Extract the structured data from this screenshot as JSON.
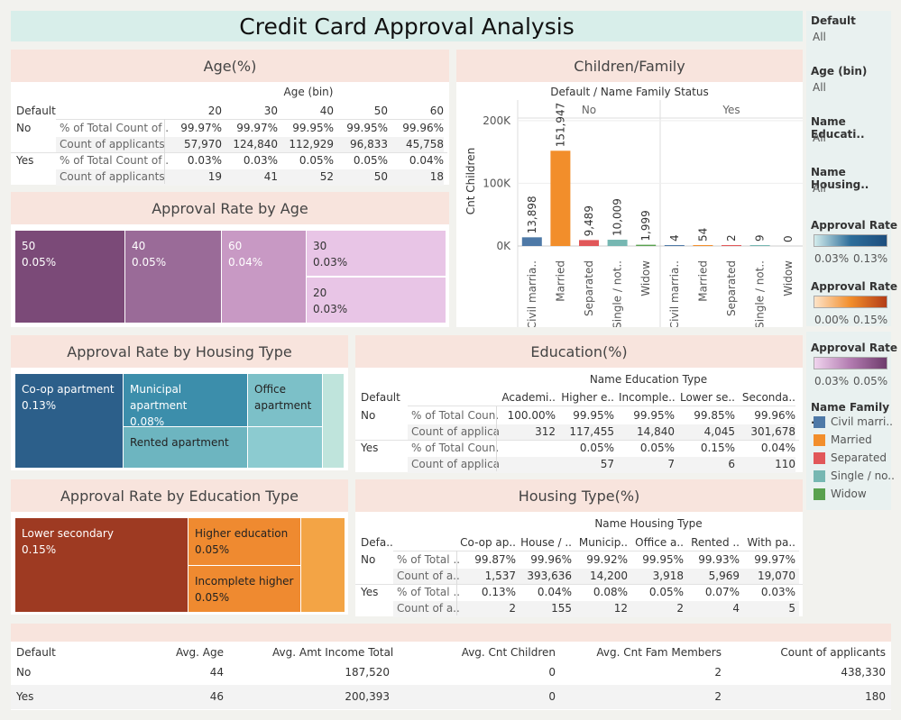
{
  "title": "Credit Card Approval Analysis",
  "filters": [
    {
      "label": "Default",
      "value": "All"
    },
    {
      "label": "Age (bin)",
      "value": "All"
    },
    {
      "label": "Name Educati..",
      "value": "All"
    },
    {
      "label": "Name Housing..",
      "value": "All"
    }
  ],
  "legends": {
    "rate1": {
      "title": "Approval Rate",
      "min": "0.03%",
      "max": "0.13%"
    },
    "rate2": {
      "title": "Approval Rate",
      "min": "0.00%",
      "max": "0.15%"
    },
    "rate3": {
      "title": "Approval Rate",
      "min": "0.03%",
      "max": "0.05%"
    },
    "family": {
      "title": "Name Family ..",
      "items": [
        {
          "label": "Civil marri..",
          "color": "#4e79a7"
        },
        {
          "label": "Married",
          "color": "#f28e2b"
        },
        {
          "label": "Separated",
          "color": "#e15759"
        },
        {
          "label": "Single / no..",
          "color": "#76b7b2"
        },
        {
          "label": "Widow",
          "color": "#59a14f"
        }
      ]
    }
  },
  "age_table": {
    "header": "Age(%)",
    "col_group": "Age (bin)",
    "row_header": "Default",
    "columns": [
      "20",
      "30",
      "40",
      "50",
      "60"
    ],
    "rows": [
      {
        "group": "No",
        "metric": "% of Total Count of ..",
        "values": [
          "99.97%",
          "99.97%",
          "99.95%",
          "99.95%",
          "99.96%"
        ]
      },
      {
        "group": "",
        "metric": "Count of applicants",
        "values": [
          "57,970",
          "124,840",
          "112,929",
          "96,833",
          "45,758"
        ]
      },
      {
        "group": "Yes",
        "metric": "% of Total Count of ..",
        "values": [
          "0.03%",
          "0.03%",
          "0.05%",
          "0.05%",
          "0.04%"
        ]
      },
      {
        "group": "",
        "metric": "Count of applicants",
        "values": [
          "19",
          "41",
          "52",
          "50",
          "18"
        ]
      }
    ]
  },
  "age_tree": {
    "header": "Approval Rate by Age",
    "tiles": [
      {
        "label": "50",
        "value": "0.05%",
        "color": "#7b4a78"
      },
      {
        "label": "40",
        "value": "0.05%",
        "color": "#9a6b98"
      },
      {
        "label": "60",
        "value": "0.04%",
        "color": "#c899c4"
      },
      {
        "label": "30",
        "value": "0.03%",
        "color": "#e8c5e6"
      },
      {
        "label": "20",
        "value": "0.03%",
        "color": "#e8c5e6"
      }
    ]
  },
  "children_chart": {
    "header": "Children/Family",
    "subtitle": "Default  /  Name Family Status",
    "ylabel": "Cnt Children",
    "groups": [
      "No",
      "Yes"
    ]
  },
  "chart_data": {
    "type": "bar",
    "title": "Children/Family",
    "ylabel": "Cnt Children",
    "ylim": [
      0,
      230000
    ],
    "yticks": [
      "200K",
      "100K",
      "0K"
    ],
    "groups": [
      "No",
      "Yes"
    ],
    "categories": [
      "Civil marria..",
      "Married",
      "Separated",
      "Single / not..",
      "Widow"
    ],
    "series": [
      {
        "name": "No",
        "values": [
          13898,
          151947,
          9489,
          10009,
          1999
        ],
        "labels": [
          "13,898",
          "151,947",
          "9,489",
          "10,009",
          "1,999"
        ]
      },
      {
        "name": "Yes",
        "values": [
          4,
          54,
          2,
          9,
          0
        ],
        "labels": [
          "4",
          "54",
          "2",
          "9",
          "0"
        ]
      }
    ],
    "bar_colors": [
      "#4e79a7",
      "#f28e2b",
      "#e15759",
      "#76b7b2",
      "#59a14f"
    ]
  },
  "housing_tree": {
    "header": "Approval Rate by Housing Type",
    "tiles": [
      {
        "label": "Co-op apartment",
        "value": "0.13%",
        "color": "#2c5f8a"
      },
      {
        "label": "Municipal apartment",
        "value": "0.08%",
        "color": "#3c8eab"
      },
      {
        "label": "Office apartment",
        "value": "",
        "color": "#7cc0c8"
      },
      {
        "label": "Rented apartment",
        "value": "",
        "color": "#6db5c0"
      },
      {
        "label": "",
        "value": "",
        "color": "#8ccbd0"
      },
      {
        "label": "",
        "value": "",
        "color": "#bfe4dc"
      }
    ]
  },
  "education_table": {
    "header": "Education(%)",
    "col_group": "Name Education Type",
    "row_header": "Default",
    "columns": [
      "Academi..",
      "Higher e..",
      "Incomple..",
      "Lower se..",
      "Seconda.."
    ],
    "rows": [
      {
        "group": "No",
        "metric": "% of Total Coun..",
        "values": [
          "100.00%",
          "99.95%",
          "99.95%",
          "99.85%",
          "99.96%"
        ]
      },
      {
        "group": "",
        "metric": "Count of applica..",
        "values": [
          "312",
          "117,455",
          "14,840",
          "4,045",
          "301,678"
        ]
      },
      {
        "group": "Yes",
        "metric": "% of Total Coun..",
        "values": [
          "",
          "0.05%",
          "0.05%",
          "0.15%",
          "0.04%"
        ]
      },
      {
        "group": "",
        "metric": "Count of applica..",
        "values": [
          "",
          "57",
          "7",
          "6",
          "110"
        ]
      }
    ]
  },
  "education_tree": {
    "header": "Approval Rate by Education Type",
    "tiles": [
      {
        "label": "Lower secondary",
        "value": "0.15%",
        "color": "#9e3a22"
      },
      {
        "label": "Higher education",
        "value": "0.05%",
        "color": "#ef8a30"
      },
      {
        "label": "Incomplete higher",
        "value": "0.05%",
        "color": "#ef8a30"
      },
      {
        "label": "",
        "value": "",
        "color": "#f3a445"
      }
    ]
  },
  "housing_table": {
    "header": "Housing Type(%)",
    "col_group": "Name Housing Type",
    "row_header": "Defa..",
    "columns": [
      "Co-op ap..",
      "House / ..",
      "Municip..",
      "Office a..",
      "Rented ..",
      "With pa.."
    ],
    "rows": [
      {
        "group": "No",
        "metric": "% of Total ..",
        "values": [
          "99.87%",
          "99.96%",
          "99.92%",
          "99.95%",
          "99.93%",
          "99.97%"
        ]
      },
      {
        "group": "",
        "metric": "Count of a..",
        "values": [
          "1,537",
          "393,636",
          "14,200",
          "3,918",
          "5,969",
          "19,070"
        ]
      },
      {
        "group": "Yes",
        "metric": "% of Total ..",
        "values": [
          "0.13%",
          "0.04%",
          "0.08%",
          "0.05%",
          "0.07%",
          "0.03%"
        ]
      },
      {
        "group": "",
        "metric": "Count of a..",
        "values": [
          "2",
          "155",
          "12",
          "2",
          "4",
          "5"
        ]
      }
    ]
  },
  "summary_table": {
    "columns": [
      "Default",
      "Avg. Age",
      "Avg. Amt Income Total",
      "Avg. Cnt Children",
      "Avg. Cnt Fam Members",
      "Count of applicants"
    ],
    "rows": [
      [
        "No",
        "44",
        "187,520",
        "0",
        "2",
        "438,330"
      ],
      [
        "Yes",
        "46",
        "200,393",
        "0",
        "2",
        "180"
      ]
    ]
  }
}
